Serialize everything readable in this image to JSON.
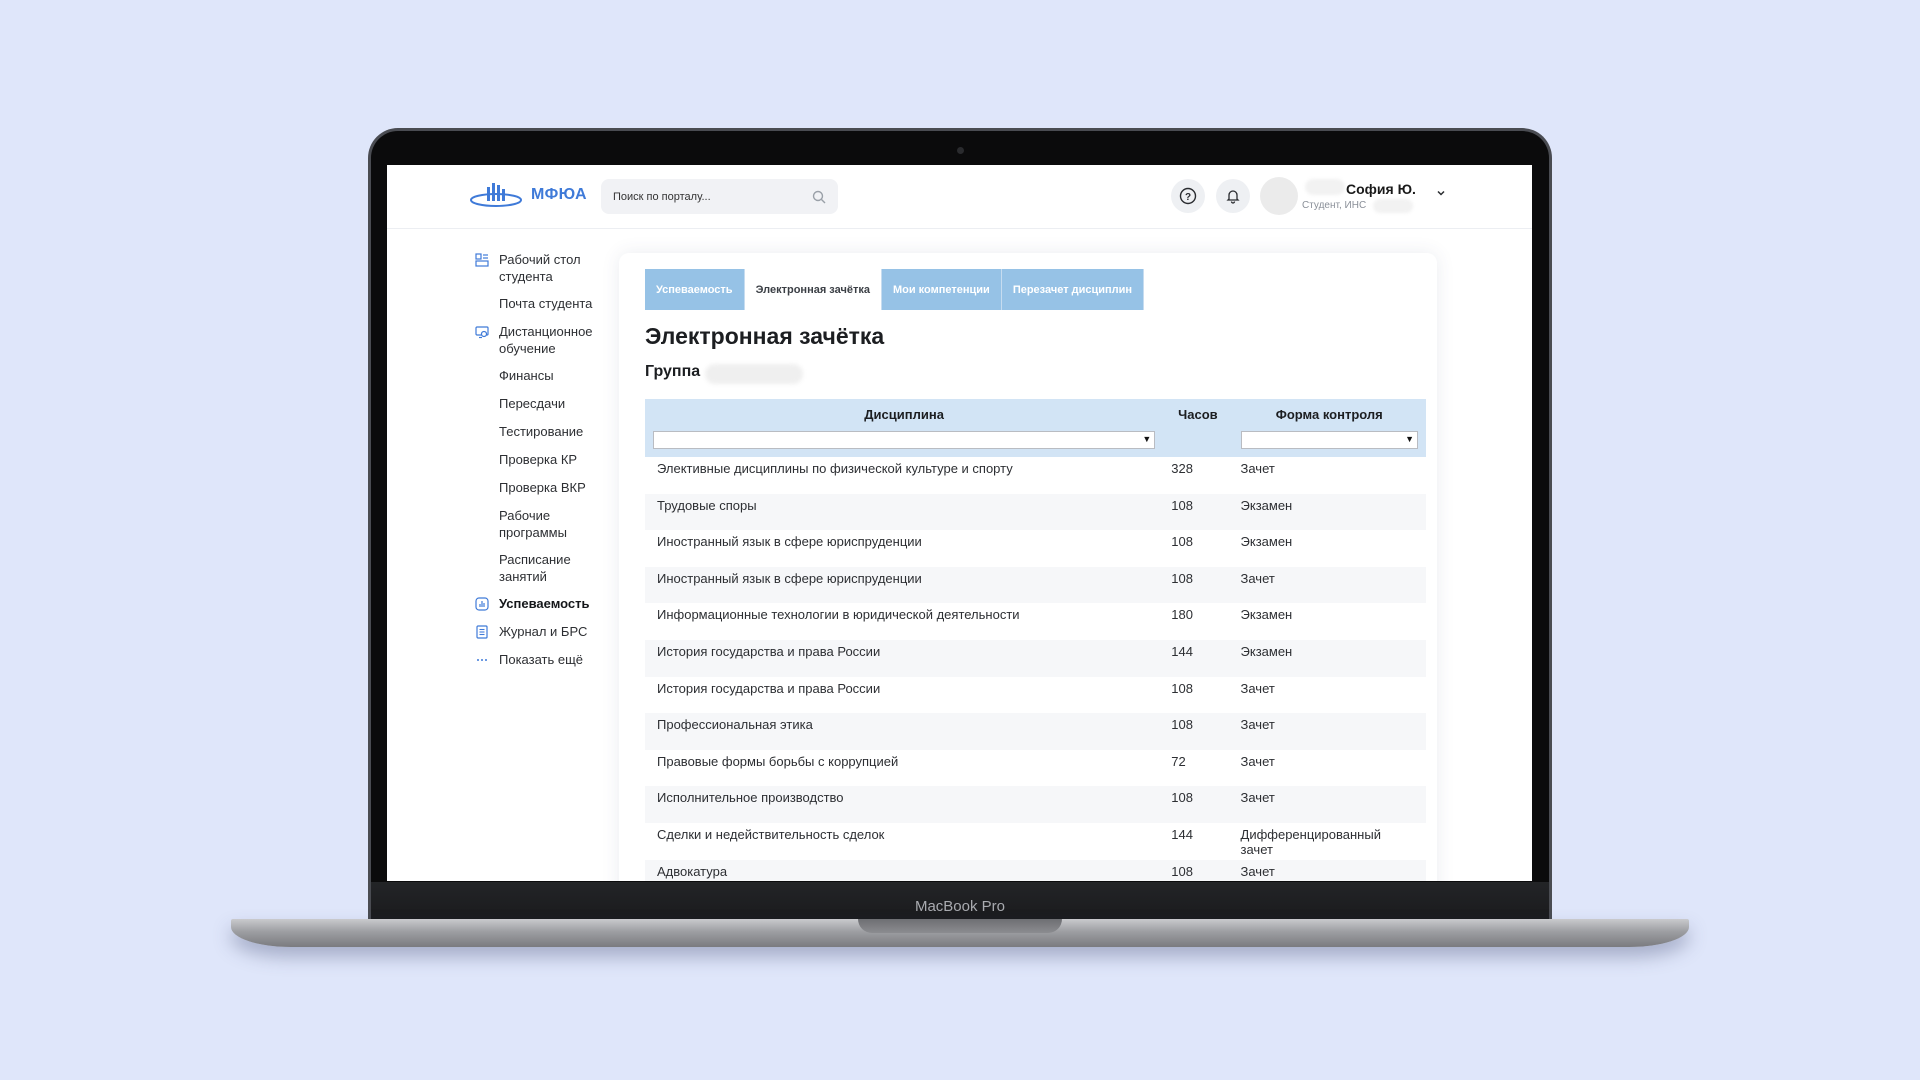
{
  "device": {
    "model_label": "MacBook Pro"
  },
  "brand": {
    "name": "МФЮА",
    "accent_color": "#3f7ad8"
  },
  "search": {
    "placeholder": "Поиск по порталу..."
  },
  "user": {
    "name": "София Ю.",
    "role": "Студент, ИНС"
  },
  "sidebar": {
    "items": [
      {
        "label": "Рабочий стол студента",
        "icon": "dashboard-icon"
      },
      {
        "label": "Почта студента",
        "icon": ""
      },
      {
        "label": "Дистанционное обучение",
        "icon": "distance-learning-icon"
      },
      {
        "label": "Финансы",
        "icon": ""
      },
      {
        "label": "Пересдачи",
        "icon": ""
      },
      {
        "label": "Тестирование",
        "icon": ""
      },
      {
        "label": "Проверка КР",
        "icon": ""
      },
      {
        "label": "Проверка ВКР",
        "icon": ""
      },
      {
        "label": "Рабочие программы",
        "icon": ""
      },
      {
        "label": "Расписание занятий",
        "icon": ""
      },
      {
        "label": "Успеваемость",
        "icon": "performance-icon",
        "active": true
      },
      {
        "label": "Журнал и БРС",
        "icon": "journal-icon"
      },
      {
        "label": "Показать ещё",
        "icon": "more-dots-icon"
      }
    ]
  },
  "tabs": [
    {
      "label": "Успеваемость",
      "active": false
    },
    {
      "label": "Электронная зачётка",
      "active": true
    },
    {
      "label": "Мои компетенции",
      "active": false
    },
    {
      "label": "Перезачет дисциплин",
      "active": false
    }
  ],
  "page": {
    "title": "Электронная зачётка",
    "group_label": "Группа"
  },
  "table": {
    "columns": [
      "Дисциплина",
      "Часов",
      "Форма контроля"
    ],
    "rows": [
      [
        "Элективные дисциплины по физической культуре и спорту",
        "328",
        "Зачет"
      ],
      [
        "Трудовые споры",
        "108",
        "Экзамен"
      ],
      [
        "Иностранный язык в сфере юриспруденции",
        "108",
        "Экзамен"
      ],
      [
        "Иностранный язык в сфере юриспруденции",
        "108",
        "Зачет"
      ],
      [
        "Информационные технологии в юридической деятельности",
        "180",
        "Экзамен"
      ],
      [
        "История государства и права России",
        "144",
        "Экзамен"
      ],
      [
        "История государства и права России",
        "108",
        "Зачет"
      ],
      [
        "Профессиональная этика",
        "108",
        "Зачет"
      ],
      [
        "Правовые формы борьбы с коррупцией",
        "72",
        "Зачет"
      ],
      [
        "Исполнительное производство",
        "108",
        "Зачет"
      ],
      [
        "Сделки и недействительность сделок",
        "144",
        "Дифференцированный зачет"
      ],
      [
        "Адвокатура",
        "108",
        "Зачет"
      ]
    ]
  }
}
